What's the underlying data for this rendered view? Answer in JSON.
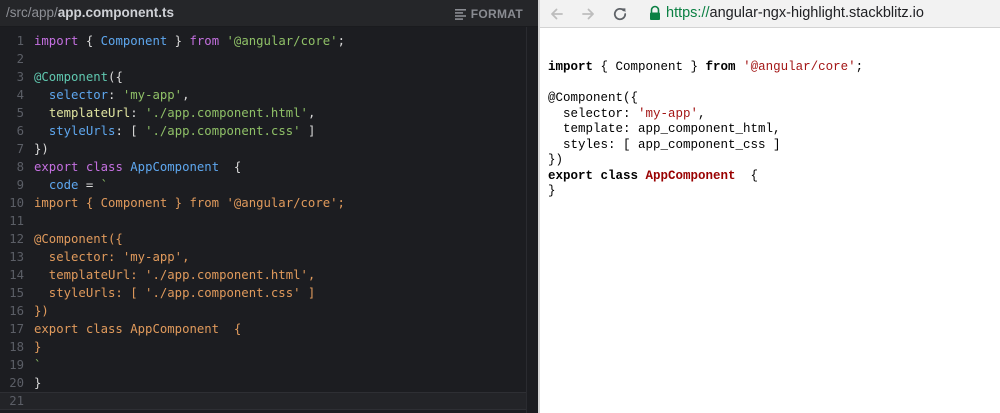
{
  "editor": {
    "path_prefix": "/src/app/",
    "file_name": "app.component.ts",
    "format_label": "FORMAT",
    "lines": [
      {
        "n": "1",
        "t": [
          [
            "kw",
            "import"
          ],
          [
            "p",
            " { "
          ],
          [
            "cls",
            "Component"
          ],
          [
            "p",
            " } "
          ],
          [
            "kw",
            "from"
          ],
          [
            "p",
            " "
          ],
          [
            "str",
            "'@angular/core'"
          ],
          [
            "p",
            ";"
          ]
        ]
      },
      {
        "n": "2",
        "t": []
      },
      {
        "n": "3",
        "t": [
          [
            "dec",
            "@Component"
          ],
          [
            "p",
            "({"
          ]
        ]
      },
      {
        "n": "4",
        "t": [
          [
            "p",
            "  "
          ],
          [
            "prop",
            "selector"
          ],
          [
            "p",
            ": "
          ],
          [
            "str",
            "'my-app'"
          ],
          [
            "p",
            ","
          ]
        ]
      },
      {
        "n": "5",
        "t": [
          [
            "p",
            "  "
          ],
          [
            "fn",
            "templateUrl"
          ],
          [
            "p",
            ": "
          ],
          [
            "str",
            "'./app.component.html'"
          ],
          [
            "p",
            ","
          ]
        ]
      },
      {
        "n": "6",
        "t": [
          [
            "p",
            "  "
          ],
          [
            "prop",
            "styleUrls"
          ],
          [
            "p",
            ": [ "
          ],
          [
            "str",
            "'./app.component.css'"
          ],
          [
            "p",
            " ]"
          ]
        ]
      },
      {
        "n": "7",
        "t": [
          [
            "p",
            "})"
          ]
        ]
      },
      {
        "n": "8",
        "t": [
          [
            "kw",
            "export"
          ],
          [
            "p",
            " "
          ],
          [
            "kw",
            "class"
          ],
          [
            "p",
            " "
          ],
          [
            "cls",
            "AppComponent"
          ],
          [
            "p",
            "  {"
          ]
        ]
      },
      {
        "n": "9",
        "t": [
          [
            "p",
            "  "
          ],
          [
            "prop",
            "code"
          ],
          [
            "p",
            " = "
          ],
          [
            "str",
            "`"
          ]
        ]
      },
      {
        "n": "10",
        "t": [
          [
            "org",
            "import { Component } from '@angular/core';"
          ]
        ]
      },
      {
        "n": "11",
        "t": []
      },
      {
        "n": "12",
        "t": [
          [
            "org",
            "@Component({"
          ]
        ]
      },
      {
        "n": "13",
        "t": [
          [
            "org",
            "  selector: 'my-app',"
          ]
        ]
      },
      {
        "n": "14",
        "t": [
          [
            "org",
            "  templateUrl: './app.component.html',"
          ]
        ]
      },
      {
        "n": "15",
        "t": [
          [
            "org",
            "  styleUrls: [ './app.component.css' ]"
          ]
        ]
      },
      {
        "n": "16",
        "t": [
          [
            "org",
            "})"
          ]
        ]
      },
      {
        "n": "17",
        "t": [
          [
            "org",
            "export class AppComponent  {"
          ]
        ]
      },
      {
        "n": "18",
        "t": [
          [
            "org",
            "}"
          ]
        ]
      },
      {
        "n": "19",
        "t": [
          [
            "str",
            "`"
          ]
        ]
      },
      {
        "n": "20",
        "t": [
          [
            "p",
            "}"
          ]
        ]
      },
      {
        "n": "21",
        "t": []
      }
    ]
  },
  "browser": {
    "url_scheme": "https://",
    "url_host": "angular-ngx-highlight.stackblitz.io",
    "preview_lines": [
      [
        [
          "pv-kw",
          "import"
        ],
        [
          "p",
          " { Component } "
        ],
        [
          "pv-kw",
          "from"
        ],
        [
          "p",
          " "
        ],
        [
          "pv-str",
          "'@angular/core'"
        ],
        [
          "p",
          ";"
        ]
      ],
      [],
      [
        [
          "p",
          "@Component({"
        ]
      ],
      [
        [
          "p",
          "  selector: "
        ],
        [
          "pv-str",
          "'my-app'"
        ],
        [
          "p",
          ","
        ]
      ],
      [
        [
          "p",
          "  template: app_component_html,"
        ]
      ],
      [
        [
          "p",
          "  styles: [ app_component_css ]"
        ]
      ],
      [
        [
          "p",
          "})"
        ]
      ],
      [
        [
          "pv-kw",
          "export class"
        ],
        [
          "p",
          " "
        ],
        [
          "pv-title",
          "AppComponent"
        ],
        [
          "p",
          "  {"
        ]
      ],
      [
        [
          "p",
          "}"
        ]
      ]
    ]
  },
  "colors": {
    "editor_bg": "#1c1d21",
    "keyword": "#c470e0",
    "class": "#5ea7ef",
    "string": "#8fc067",
    "secure_green": "#0b8043"
  },
  "icons": [
    "format-icon",
    "back-arrow-icon",
    "forward-arrow-icon",
    "reload-icon",
    "lock-icon"
  ]
}
